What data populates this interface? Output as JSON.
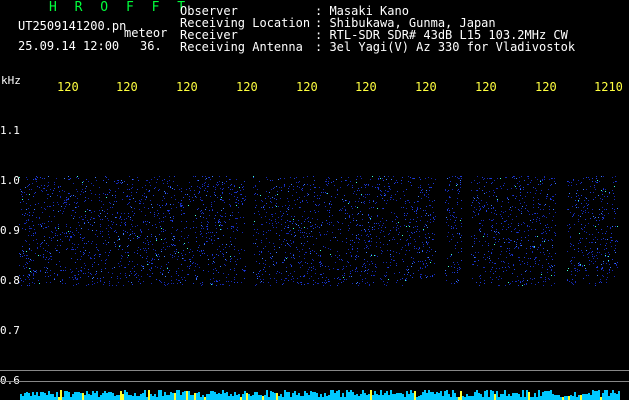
{
  "header": {
    "title": "H R O F F T",
    "filename": "UT2509141200.pn",
    "mode": "meteor",
    "datetime": "25.09.14 12:00",
    "count": "36.",
    "rows": [
      {
        "label": "Observer",
        "value": ": Masaki Kano"
      },
      {
        "label": "Receiving Location",
        "value": ": Shibukawa, Gunma, Japan"
      },
      {
        "label": "Receiver",
        "value": ": RTL-SDR SDR# 43dB L15 103.2MHz CW"
      },
      {
        "label": "Receiving Antenna",
        "value": ": 3el Yagi(V) Az 330 for Vladivostok"
      }
    ]
  },
  "axes": {
    "y_unit": "kHz",
    "y_ticks": [
      "1.1",
      "1.0",
      "0.9",
      "0.8",
      "0.7",
      "0.6"
    ],
    "x_ticks": [
      "120",
      "120",
      "120",
      "120",
      "120",
      "120",
      "120",
      "120",
      "120",
      "1210"
    ]
  },
  "colors": {
    "header_green": "#00ff3c",
    "tick_yellow": "#ffff40",
    "signal_blue": "#1a32d0",
    "baseline_cyan": "#00c8ff"
  }
}
